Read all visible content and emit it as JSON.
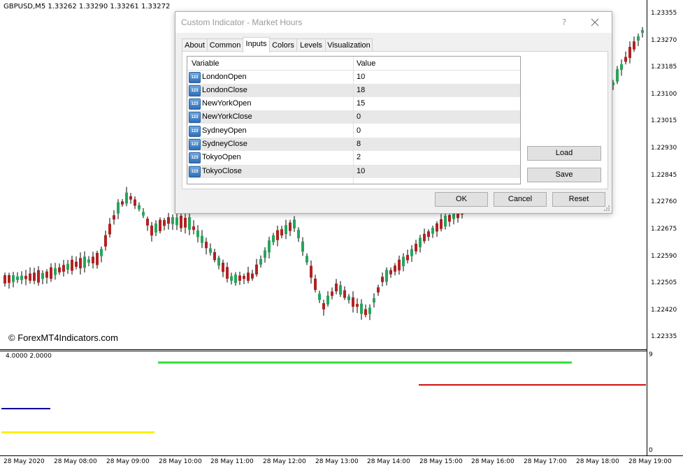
{
  "chart": {
    "symbol_header": "GBPUSD,M5  1.33262 1.33290 1.33261 1.33272",
    "watermark": "© ForexMT4Indicators.com",
    "indicator_header": "4.0000 2.0000",
    "price_axis": [
      "1.23355",
      "1.23270",
      "1.23185",
      "1.23100",
      "1.23015",
      "1.22930",
      "1.22845",
      "1.22760",
      "1.22675",
      "1.22590",
      "1.22505",
      "1.22420",
      "1.22335"
    ],
    "time_axis": [
      "28 May 2020",
      "28 May 08:00",
      "28 May 09:00",
      "28 May 10:00",
      "28 May 11:00",
      "28 May 12:00",
      "28 May 13:00",
      "28 May 14:00",
      "28 May 15:00",
      "28 May 16:00",
      "28 May 17:00",
      "28 May 18:00",
      "28 May 19:00"
    ],
    "indicator_scale": {
      "max": "9",
      "min": "0"
    },
    "colors": {
      "bull": "#26a65b",
      "bear": "#b22222",
      "green_line": "#33dd33",
      "red_line": "#cc1111",
      "blue_line": "#000099",
      "yellow_line": "#ffee00"
    }
  },
  "dialog": {
    "title": "Custom Indicator - Market Hours",
    "help": "?",
    "close_icon": "close-icon",
    "tabs": [
      "About",
      "Common",
      "Inputs",
      "Colors",
      "Levels",
      "Visualization"
    ],
    "active_tab": "Inputs",
    "grid": {
      "headers": {
        "variable": "Variable",
        "value": "Value"
      },
      "icon_text": "123",
      "rows": [
        {
          "name": "LondonOpen",
          "value": "10"
        },
        {
          "name": "LondonClose",
          "value": "18"
        },
        {
          "name": "NewYorkOpen",
          "value": "15"
        },
        {
          "name": "NewYorkClose",
          "value": "0"
        },
        {
          "name": "SydneyOpen",
          "value": "0"
        },
        {
          "name": "SydneyClose",
          "value": "8"
        },
        {
          "name": "TokyoOpen",
          "value": "2"
        },
        {
          "name": "TokyoClose",
          "value": "10"
        }
      ]
    },
    "buttons": {
      "load": "Load",
      "save": "Save",
      "ok": "OK",
      "cancel": "Cancel",
      "reset": "Reset"
    }
  }
}
